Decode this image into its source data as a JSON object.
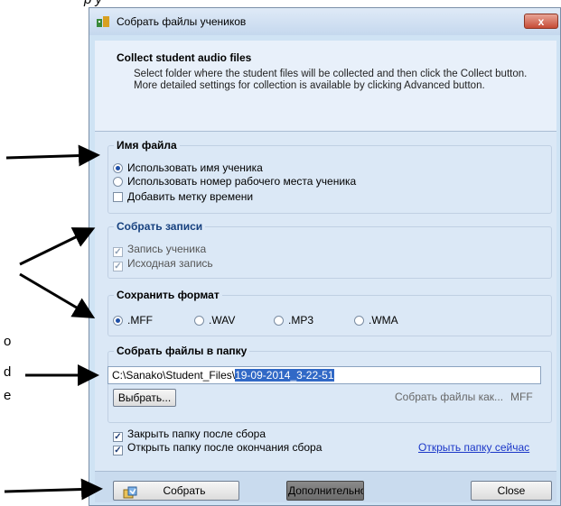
{
  "page_fragments": {
    "top_text": "р у",
    "left_marks": [
      "о",
      "d",
      "e"
    ]
  },
  "dialog": {
    "title": "Собрать файлы учеников",
    "close_label": "x",
    "header": {
      "title": "Collect student audio files",
      "description": "Select folder where the student files will be collected and then click the Collect button. More detailed settings for collection is available by clicking Advanced button."
    },
    "file_name_group": {
      "title": "Имя файла",
      "options": [
        "Использовать имя ученика",
        "Использовать номер рабочего места ученика"
      ],
      "selected": 0,
      "timestamp_label": "Добавить метку времени",
      "timestamp_checked": false
    },
    "records_group": {
      "title": "Собрать записи",
      "items": [
        {
          "label": "Запись ученика",
          "checked": true
        },
        {
          "label": "Исходная запись",
          "checked": true
        }
      ]
    },
    "format_group": {
      "title": "Сохранить формат",
      "options": [
        ".MFF",
        ".WAV",
        ".MP3",
        ".WMA"
      ],
      "selected": 0
    },
    "folder_group": {
      "title": "Собрать файлы в папку",
      "path_prefix": "C:\\Sanako\\Student_Files\\",
      "path_selected": "19-09-2014_3-22-51",
      "browse_label": "Выбрать...",
      "collect_as_label": "Собрать файлы как...",
      "collect_as_value": "MFF"
    },
    "close_folder_label": "Закрыть папку после сбора",
    "close_folder_checked": true,
    "open_folder_label": "Открыть папку после окончания сбора",
    "open_folder_checked": true,
    "open_now_link": "Открыть папку сейчас",
    "footer": {
      "collect_label": "Собрать",
      "advanced_label": "Дополнительно",
      "close_label": "Close"
    }
  }
}
